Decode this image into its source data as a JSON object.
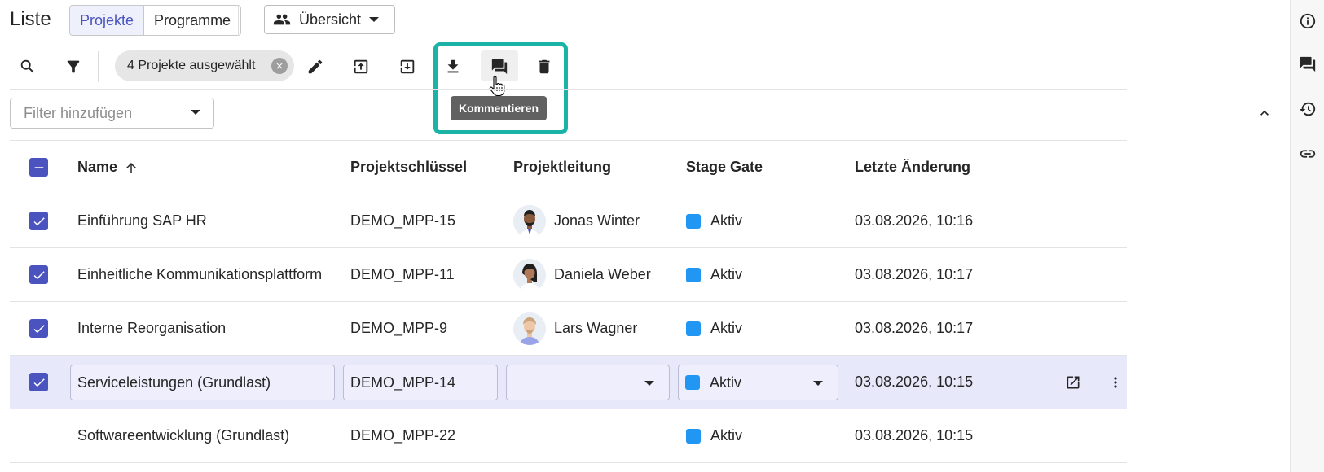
{
  "header": {
    "title": "Liste",
    "tabs": [
      {
        "label": "Projekte",
        "active": true
      },
      {
        "label": "Programme",
        "active": false
      }
    ],
    "view_select": "Übersicht"
  },
  "toolbar": {
    "selection_chip": "4 Projekte ausgewählt",
    "tooltip": "Kommentieren",
    "highlight_color": "#1ab3a5"
  },
  "filter": {
    "placeholder": "Filter hinzufügen"
  },
  "table": {
    "columns": {
      "name": "Name",
      "key": "Projektschlüssel",
      "lead": "Projektleitung",
      "stage": "Stage Gate",
      "modified": "Letzte Änderung"
    },
    "rows": [
      {
        "name": "Einführung SAP HR",
        "key": "DEMO_MPP-15",
        "lead": "Jonas Winter",
        "stage": "Aktiv",
        "modified": "03.08.2026, 10:16",
        "checked": true
      },
      {
        "name": "Einheitliche Kommunikationsplattform",
        "key": "DEMO_MPP-11",
        "lead": "Daniela Weber",
        "stage": "Aktiv",
        "modified": "03.08.2026, 10:17",
        "checked": true
      },
      {
        "name": "Interne Reorganisation",
        "key": "DEMO_MPP-9",
        "lead": "Lars Wagner",
        "stage": "Aktiv",
        "modified": "03.08.2026, 10:17",
        "checked": true
      },
      {
        "name": "Serviceleistungen (Grundlast)",
        "key": "DEMO_MPP-14",
        "lead": "",
        "stage": "Aktiv",
        "modified": "03.08.2026, 10:15",
        "checked": true
      },
      {
        "name": "Softwareentwicklung (Grundlast)",
        "key": "DEMO_MPP-22",
        "lead": "",
        "stage": "Aktiv",
        "modified": "03.08.2026, 10:15",
        "checked": false
      }
    ]
  },
  "colors": {
    "accent": "#4b53bf",
    "status_active": "#2196f3",
    "selected_row": "#e8e8fb"
  }
}
